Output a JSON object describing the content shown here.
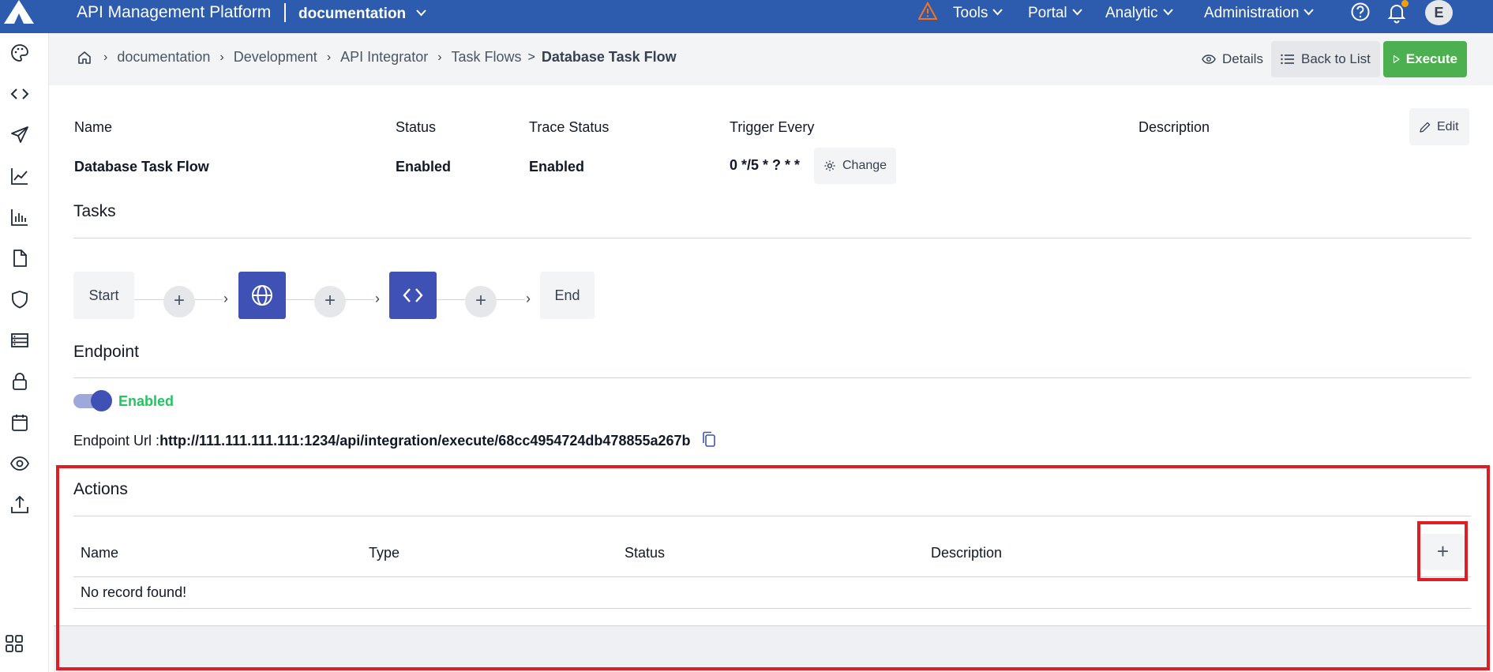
{
  "topbar": {
    "app_title": "API Management Platform",
    "workspace": "documentation",
    "nav": [
      "Tools",
      "Portal",
      "Analytic",
      "Administration"
    ],
    "avatar_initial": "E",
    "brand_color": "#2d5cae"
  },
  "sidebar": {
    "icons": [
      "palette-icon",
      "code-icon",
      "send-icon",
      "trending-up-icon",
      "bar-chart-icon",
      "file-icon",
      "shield-icon",
      "server-icon",
      "lock-icon",
      "calendar-icon",
      "eye-icon",
      "upload-icon",
      "apps-grid-icon"
    ]
  },
  "breadcrumb": {
    "items": [
      "documentation",
      "Development",
      "API Integrator",
      "Task Flows"
    ],
    "current": "Database Task Flow"
  },
  "header_actions": {
    "details": "Details",
    "back": "Back to List",
    "execute": "Execute"
  },
  "summary": {
    "labels": {
      "name": "Name",
      "status": "Status",
      "trace_status": "Trace Status",
      "trigger_every": "Trigger Every",
      "description": "Description"
    },
    "values": {
      "name": "Database Task Flow",
      "status": "Enabled",
      "trace_status": "Enabled",
      "trigger_every": "0 */5 * ? * *"
    },
    "change_label": "Change",
    "edit_label": "Edit"
  },
  "tasks": {
    "title": "Tasks",
    "start": "Start",
    "end": "End",
    "plus": "+"
  },
  "endpoint": {
    "title": "Endpoint",
    "toggle_on": true,
    "enabled_text": "Enabled",
    "url_label": "Endpoint Url :",
    "url": "http://111.111.111.111:1234/api/integration/execute/68cc4954724db478855a267b"
  },
  "actions": {
    "title": "Actions",
    "columns": [
      "Name",
      "Type",
      "Status",
      "Description"
    ],
    "empty_text": "No record found!",
    "add": "+"
  },
  "colors": {
    "execute": "#4caf50",
    "task_node": "#3f51b5",
    "enabled": "#22c55e",
    "highlight": "#e11d24"
  }
}
